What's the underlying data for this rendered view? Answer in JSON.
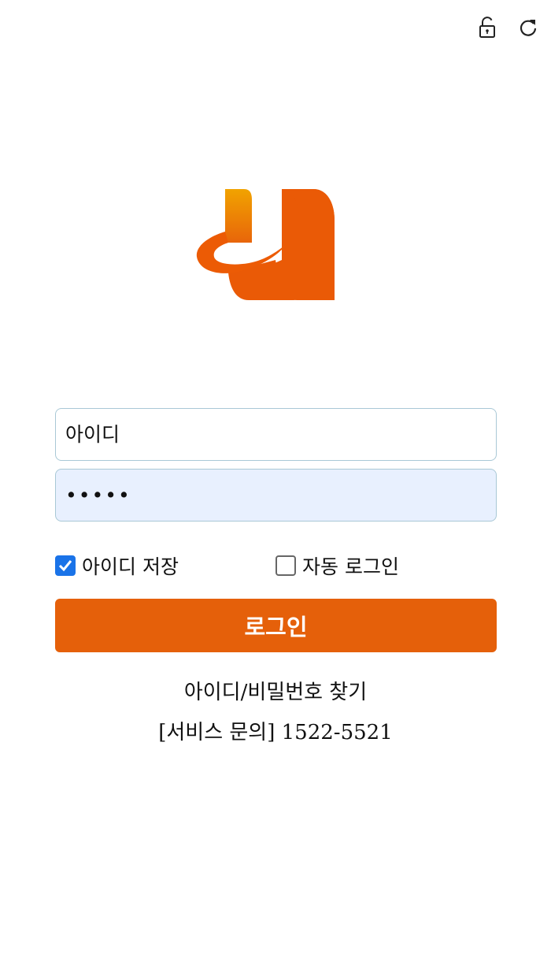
{
  "toolbar": {
    "lock_icon": "unlock-icon",
    "refresh_icon": "refresh-icon"
  },
  "logo": {
    "icon": "brand-logo",
    "colors": {
      "primary": "#e85a0c",
      "gradient_top": "#f0a000"
    }
  },
  "login_form": {
    "username_placeholder": "아이디",
    "password_value": "*****",
    "save_id_label": "아이디 저장",
    "save_id_checked": true,
    "auto_login_label": "자동 로그인",
    "auto_login_checked": false,
    "submit_label": "로그인"
  },
  "footer": {
    "find_account": "아이디/비밀번호 찾기",
    "service_inquiry": "[서비스 문의] 1522-5521"
  },
  "colors": {
    "accent": "#e5600a",
    "checkbox_blue": "#1a73e8",
    "field_border": "#a9c8d6",
    "password_bg": "#e8f0fe"
  }
}
